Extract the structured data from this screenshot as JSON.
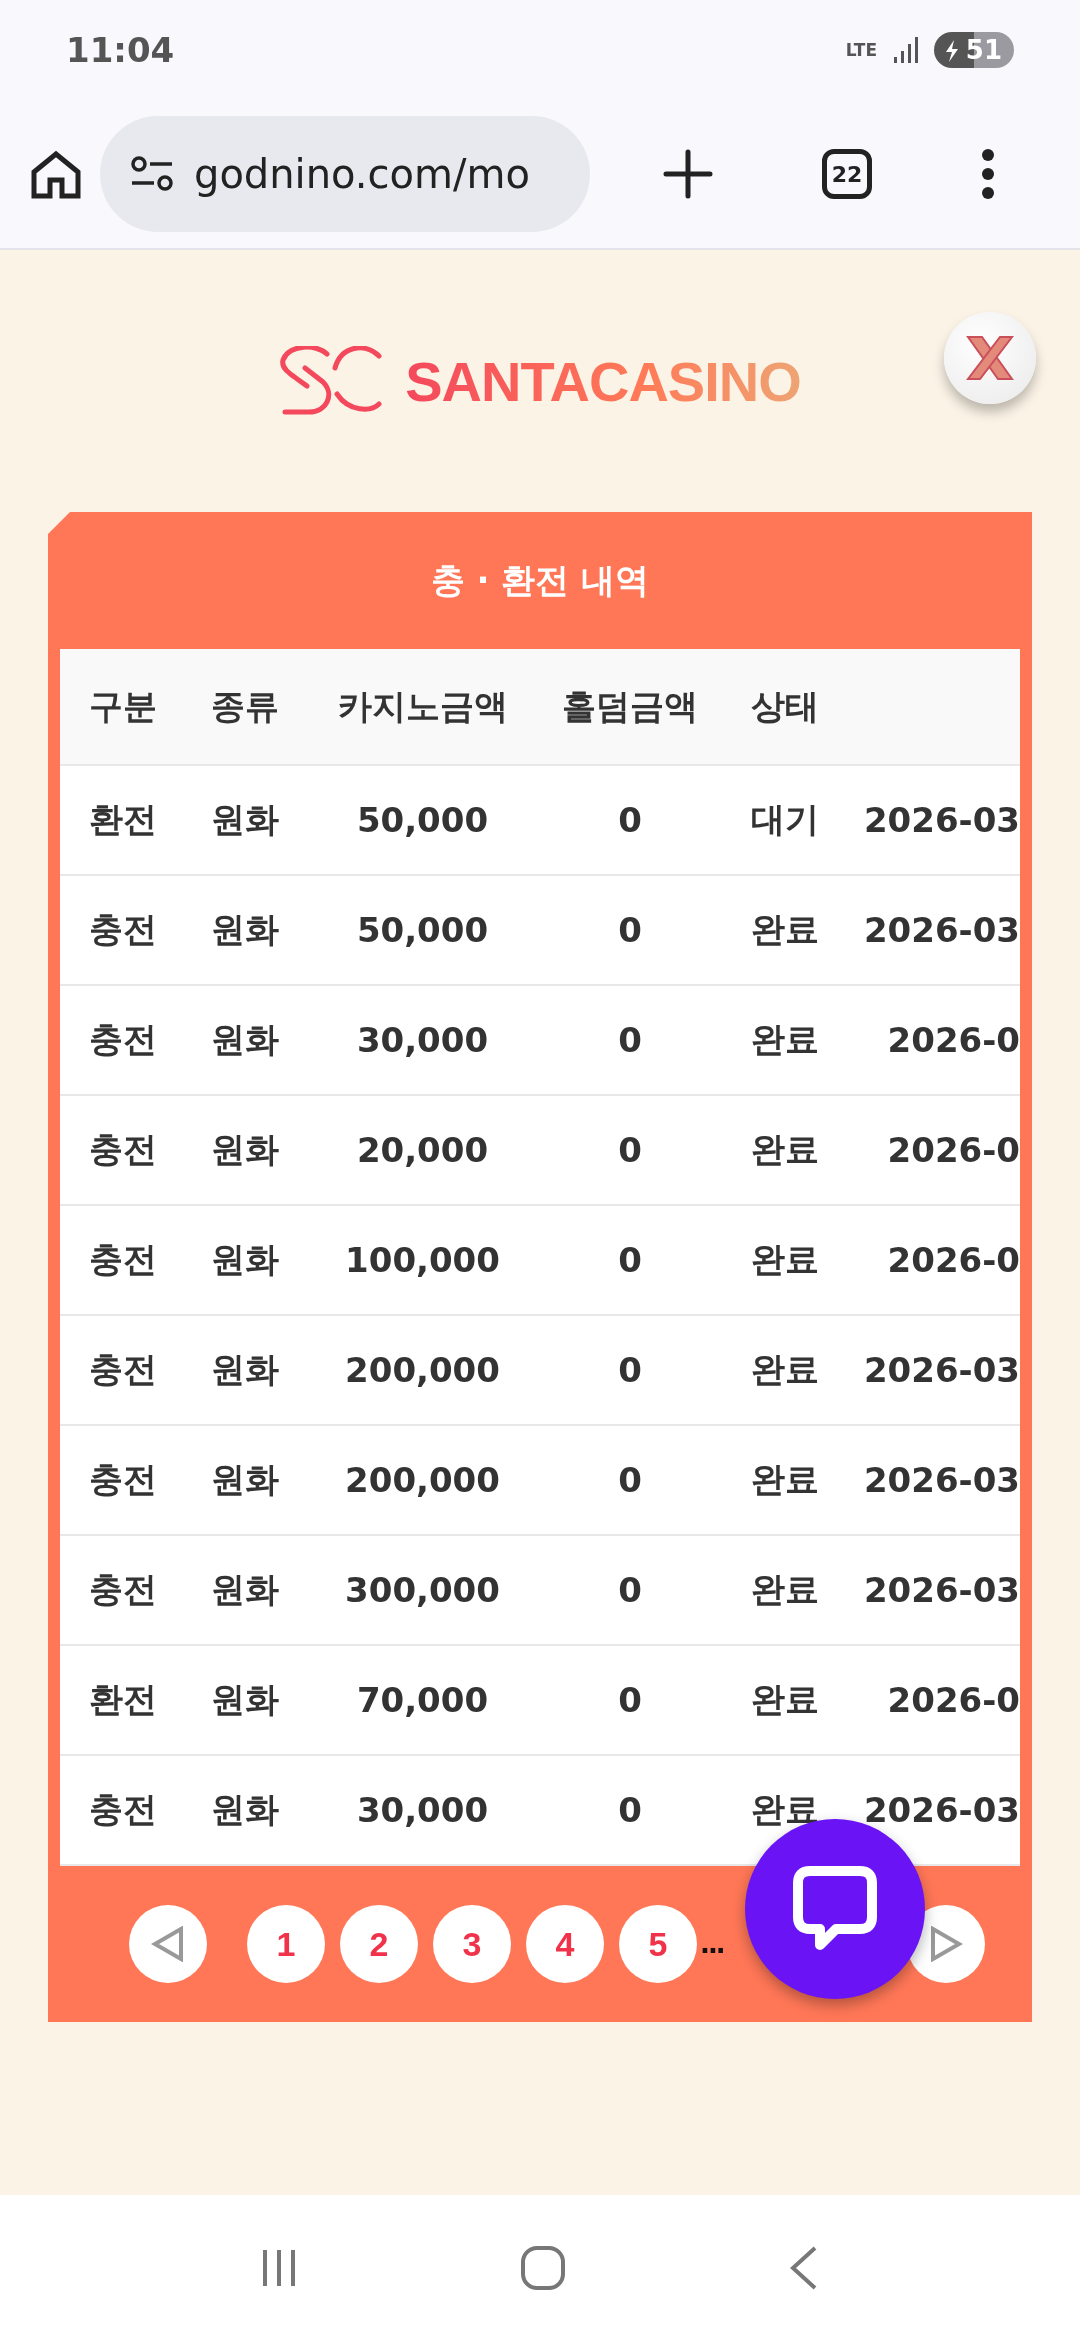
{
  "status_bar": {
    "time": "11:04",
    "network": "LTE",
    "battery": "51"
  },
  "browser": {
    "url": "godnino.com/mo",
    "tab_count": "22"
  },
  "logo": {
    "text": "SANTACASINO"
  },
  "panel": {
    "title": "충 · 환전 내역"
  },
  "table": {
    "columns": [
      "구분",
      "종류",
      "카지노금액",
      "홀덤금액",
      "상태"
    ],
    "rows": [
      [
        "환전",
        "원화",
        "50,000",
        "0",
        "대기",
        "2026-03"
      ],
      [
        "충전",
        "원화",
        "50,000",
        "0",
        "완료",
        "2026-03"
      ],
      [
        "충전",
        "원화",
        "30,000",
        "0",
        "완료",
        "2026-0"
      ],
      [
        "충전",
        "원화",
        "20,000",
        "0",
        "완료",
        "2026-0"
      ],
      [
        "충전",
        "원화",
        "100,000",
        "0",
        "완료",
        "2026-0"
      ],
      [
        "충전",
        "원화",
        "200,000",
        "0",
        "완료",
        "2026-03"
      ],
      [
        "충전",
        "원화",
        "200,000",
        "0",
        "완료",
        "2026-03"
      ],
      [
        "충전",
        "원화",
        "300,000",
        "0",
        "완료",
        "2026-03"
      ],
      [
        "환전",
        "원화",
        "70,000",
        "0",
        "완료",
        "2026-0"
      ],
      [
        "충전",
        "원화",
        "30,000",
        "0",
        "완료",
        "2026-03"
      ]
    ]
  },
  "pagination": {
    "pages": [
      "1",
      "2",
      "3",
      "4",
      "5"
    ],
    "ellipsis": "..."
  }
}
